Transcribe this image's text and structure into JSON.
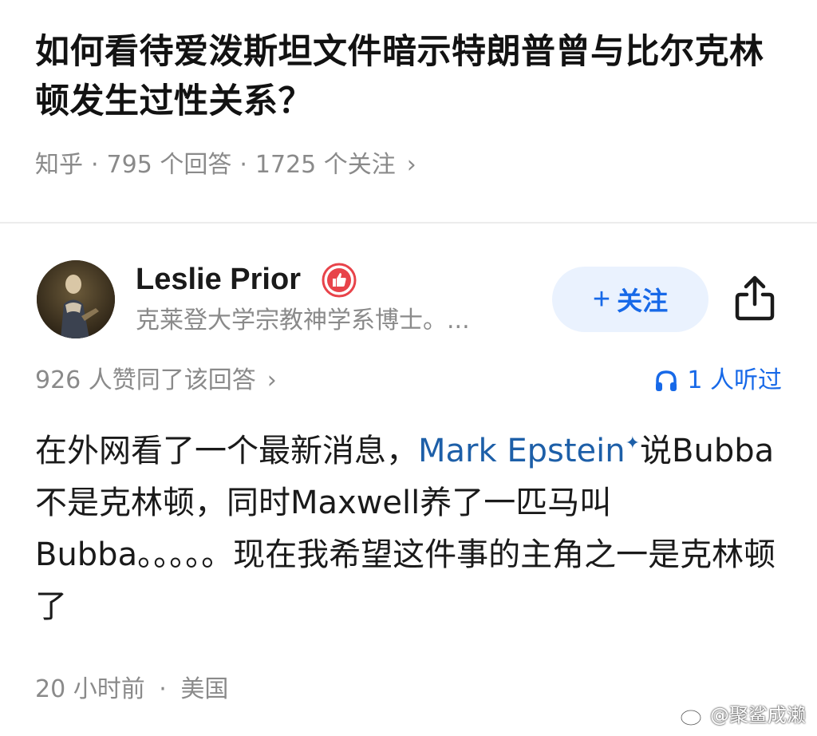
{
  "question": {
    "title": "如何看待爱泼斯坦文件暗示特朗普曾与比尔克林顿发生过性关系？",
    "source": "知乎",
    "answer_count": "795 个回答",
    "follower_count": "1725 个关注",
    "separator": "·",
    "chevron": "›"
  },
  "author": {
    "name": "Leslie Prior",
    "bio": "克莱登大学宗教神学系博士。...",
    "follow_label": "关注",
    "follow_plus": "+",
    "badge_icon": "thumbs-up-badge-icon",
    "share_icon": "share-icon"
  },
  "stats": {
    "votes": "926 人赞同了该回答",
    "chevron": "›",
    "listened": "1 人听过",
    "listen_icon": "headphones-icon"
  },
  "answer": {
    "text_before_link": "在外网看了一个最新消息，",
    "link_text": "Mark Epstein",
    "link_mark": "✦",
    "text_after_link": "说Bubba不是克林顿，同时Maxwell养了一匹马叫Bubba。。。。。现在我希望这件事的主角之一是克林顿了"
  },
  "footer": {
    "time": "20 小时前",
    "separator": "·",
    "location": "美国"
  },
  "watermark": {
    "text": "@聚鲨成濑",
    "icon": "weibo-icon"
  },
  "colors": {
    "accent_blue": "#1769e8",
    "link_blue": "#1d5fa8",
    "follow_bg": "#eaf2fe",
    "meta_gray": "#8a8a8a",
    "badge_red": "#e8434a"
  }
}
